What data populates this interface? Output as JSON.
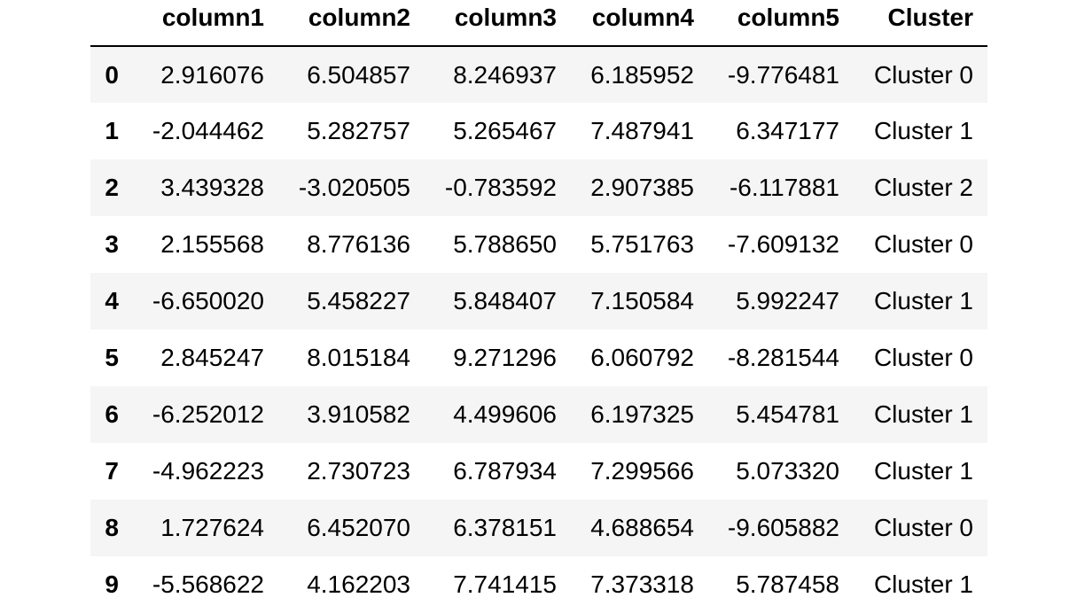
{
  "table": {
    "index_header": "",
    "columns": [
      "column1",
      "column2",
      "column3",
      "column4",
      "column5",
      "Cluster"
    ],
    "rows": [
      {
        "index": "0",
        "cells": [
          "2.916076",
          "6.504857",
          "8.246937",
          "6.185952",
          "-9.776481",
          "Cluster 0"
        ]
      },
      {
        "index": "1",
        "cells": [
          "-2.044462",
          "5.282757",
          "5.265467",
          "7.487941",
          "6.347177",
          "Cluster 1"
        ]
      },
      {
        "index": "2",
        "cells": [
          "3.439328",
          "-3.020505",
          "-0.783592",
          "2.907385",
          "-6.117881",
          "Cluster 2"
        ]
      },
      {
        "index": "3",
        "cells": [
          "2.155568",
          "8.776136",
          "5.788650",
          "5.751763",
          "-7.609132",
          "Cluster 0"
        ]
      },
      {
        "index": "4",
        "cells": [
          "-6.650020",
          "5.458227",
          "5.848407",
          "7.150584",
          "5.992247",
          "Cluster 1"
        ]
      },
      {
        "index": "5",
        "cells": [
          "2.845247",
          "8.015184",
          "9.271296",
          "6.060792",
          "-8.281544",
          "Cluster 0"
        ]
      },
      {
        "index": "6",
        "cells": [
          "-6.252012",
          "3.910582",
          "4.499606",
          "6.197325",
          "5.454781",
          "Cluster 1"
        ]
      },
      {
        "index": "7",
        "cells": [
          "-4.962223",
          "2.730723",
          "6.787934",
          "7.299566",
          "5.073320",
          "Cluster 1"
        ]
      },
      {
        "index": "8",
        "cells": [
          "1.727624",
          "6.452070",
          "6.378151",
          "4.688654",
          "-9.605882",
          "Cluster 0"
        ]
      },
      {
        "index": "9",
        "cells": [
          "-5.568622",
          "4.162203",
          "7.741415",
          "7.373318",
          "5.787458",
          "Cluster 1"
        ]
      }
    ]
  }
}
